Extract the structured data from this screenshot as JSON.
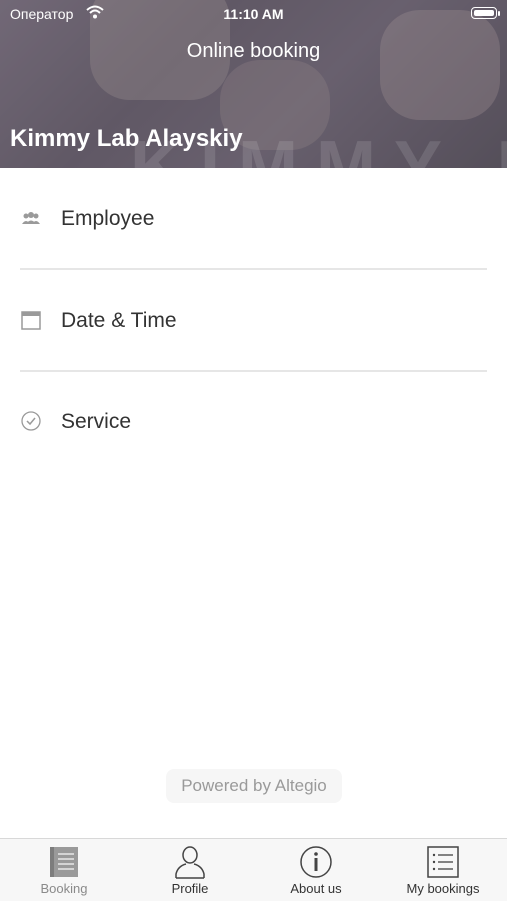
{
  "status_bar": {
    "carrier": "Оператор",
    "time": "11:10 AM"
  },
  "header": {
    "title": "Online booking",
    "company": "Kimmy Lab Alayskiy",
    "watermark": "KIMMY LA"
  },
  "menu": [
    {
      "label": "Employee",
      "icon": "people-icon"
    },
    {
      "label": "Date & Time",
      "icon": "calendar-icon"
    },
    {
      "label": "Service",
      "icon": "check-circle-icon"
    }
  ],
  "footer": {
    "powered_by": "Powered by Altegio"
  },
  "tabs": [
    {
      "label": "Booking",
      "icon": "booking-icon",
      "active": true
    },
    {
      "label": "Profile",
      "icon": "profile-icon",
      "active": false
    },
    {
      "label": "About us",
      "icon": "info-icon",
      "active": false
    },
    {
      "label": "My bookings",
      "icon": "list-icon",
      "active": false
    }
  ],
  "colors": {
    "active_tab": "#8a8a8a",
    "text": "#333333",
    "divider": "#e6e6e6"
  }
}
